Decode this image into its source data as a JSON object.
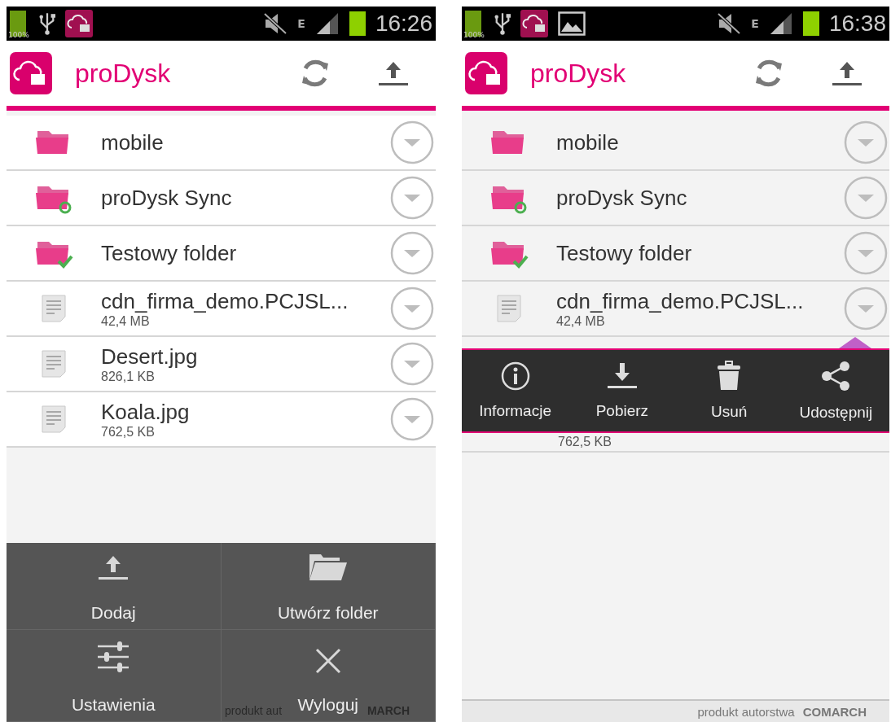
{
  "screens": [
    {
      "status_bar": {
        "battery_label": "100%",
        "notifications": [
          {
            "kind": "usb"
          },
          {
            "kind": "app"
          }
        ],
        "network": "E",
        "time": "16:26"
      },
      "app_bar": {
        "title": "proDysk"
      },
      "dimmed": false,
      "files": [
        {
          "kind": "folder",
          "name": "mobile"
        },
        {
          "kind": "sync-folder",
          "name": "proDysk Sync"
        },
        {
          "kind": "synced-folder",
          "name": "Testowy folder"
        },
        {
          "kind": "file",
          "name": "cdn_firma_demo.PCJSL...",
          "size": "42,4 MB"
        },
        {
          "kind": "file",
          "name": "Desert.jpg",
          "size": "826,1 KB"
        },
        {
          "kind": "file",
          "name": "Koala.jpg",
          "size": "762,5 KB"
        }
      ],
      "menu": [
        {
          "kind": "upload",
          "label": "Dodaj"
        },
        {
          "kind": "new-folder",
          "label": "Utwórz folder"
        },
        {
          "kind": "settings",
          "label": "Ustawienia"
        },
        {
          "kind": "logout",
          "label": "Wyloguj"
        }
      ],
      "footer": {
        "text": "produkt aut",
        "brand": "MARCH"
      }
    },
    {
      "status_bar": {
        "battery_label": "100%",
        "notifications": [
          {
            "kind": "usb"
          },
          {
            "kind": "app"
          },
          {
            "kind": "image"
          }
        ],
        "network": "E",
        "time": "16:38"
      },
      "app_bar": {
        "title": "proDysk"
      },
      "dimmed": true,
      "files": [
        {
          "kind": "folder",
          "name": "mobile"
        },
        {
          "kind": "sync-folder",
          "name": "proDysk Sync"
        },
        {
          "kind": "synced-folder",
          "name": "Testowy folder"
        },
        {
          "kind": "file",
          "name": "cdn_firma_demo.PCJSL...",
          "size": "42,4 MB"
        }
      ],
      "popup": [
        {
          "kind": "info",
          "label": "Informacje"
        },
        {
          "kind": "download",
          "label": "Pobierz"
        },
        {
          "kind": "delete",
          "label": "Usuń"
        },
        {
          "kind": "share",
          "label": "Udostępnij"
        }
      ],
      "partial_row": {
        "size": "762,5 KB"
      },
      "footer": {
        "text": "produkt autorstwa",
        "brand": "COMARCH"
      }
    }
  ]
}
